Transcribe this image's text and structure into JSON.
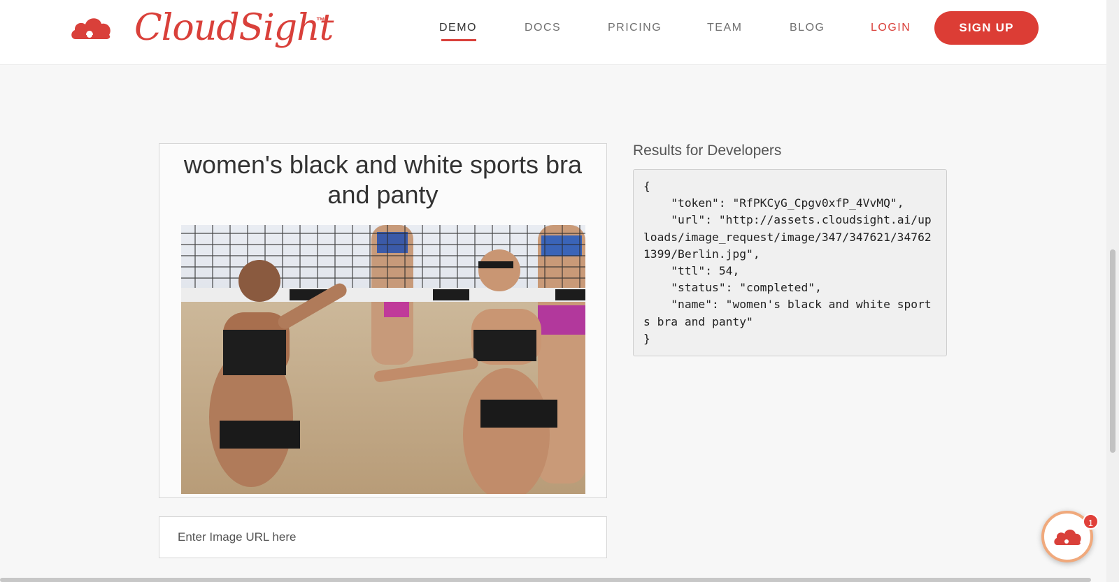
{
  "header": {
    "logo_text": "CloudSight",
    "logo_tm": "™",
    "nav": {
      "demo": "DEMO",
      "docs": "DOCS",
      "pricing": "PRICING",
      "team": "TEAM",
      "blog": "BLOG",
      "login": "LOGIN"
    },
    "signup_label": "SIGN UP"
  },
  "result": {
    "title": "women's black and white sports bra and panty"
  },
  "url_input": {
    "placeholder": "Enter Image URL here"
  },
  "developer": {
    "heading": "Results for Developers",
    "json_text": "{\n    \"token\": \"RfPKCyG_Cpgv0xfP_4VvMQ\",\n    \"url\": \"http://assets.cloudsight.ai/uploads/image_request/image/347/347621/347621399/Berlin.jpg\",\n    \"ttl\": 54,\n    \"status\": \"completed\",\n    \"name\": \"women's black and white sports bra and panty\"\n}"
  },
  "chat": {
    "badge_count": "1"
  },
  "colors": {
    "brand_red": "#dc3d35",
    "page_bg": "#f7f7f7"
  },
  "icons": {
    "logo": "cloud-logo-icon",
    "chat": "cloud-chat-icon"
  }
}
